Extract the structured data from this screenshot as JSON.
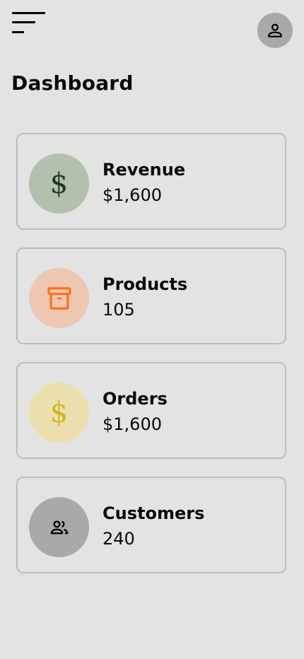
{
  "header": {
    "title": "Dashboard"
  },
  "stats": {
    "revenue": {
      "label": "Revenue",
      "value": "$1,600",
      "icon": "dollar-icon",
      "circle_color": "#b2c0ad",
      "icon_color": "#1e3a1e"
    },
    "products": {
      "label": "Products",
      "value": "105",
      "icon": "archive-box-icon",
      "circle_color": "#edc7b1",
      "icon_color": "#ff6f1f"
    },
    "orders": {
      "label": "Orders",
      "value": "$1,600",
      "icon": "dollar-icon",
      "circle_color": "#ebe0ad",
      "icon_color": "#d1b51f"
    },
    "customers": {
      "label": "Customers",
      "value": "240",
      "icon": "people-icon",
      "circle_color": "#a9a9a9",
      "icon_color": "#000000"
    }
  }
}
